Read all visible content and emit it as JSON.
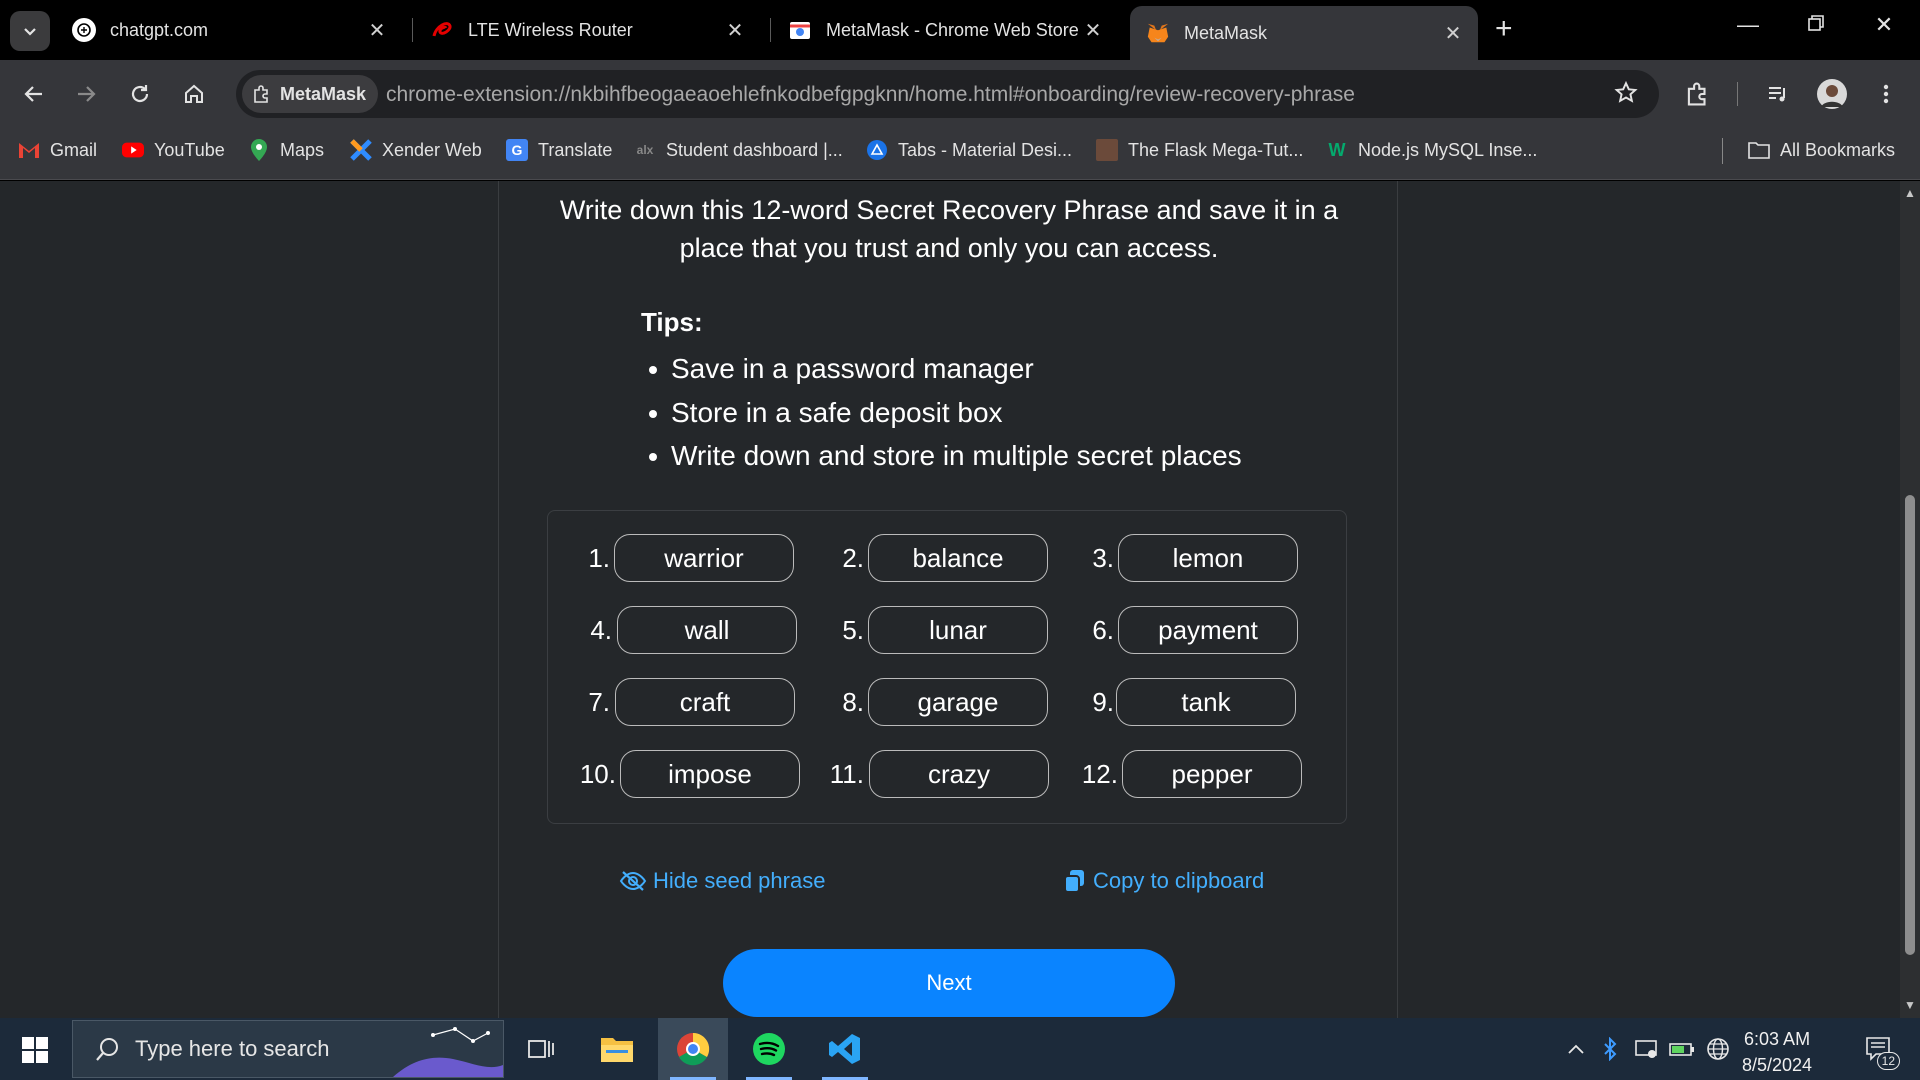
{
  "tabs": [
    {
      "title": "chatgpt.com",
      "icon": "chatgpt-icon"
    },
    {
      "title": "LTE Wireless Router",
      "icon": "airtel-icon"
    },
    {
      "title": "MetaMask - Chrome Web Store",
      "icon": "chrome-web-store-icon"
    },
    {
      "title": "MetaMask",
      "icon": "metamask-fox-icon",
      "active": true
    }
  ],
  "toolbar": {
    "site_chip": "MetaMask",
    "url": "chrome-extension://nkbihfbeogaeaoehlefnkodbefgpgknn/home.html#onboarding/review-recovery-phrase"
  },
  "bookmarks": [
    {
      "label": "Gmail",
      "icon": "gmail-icon"
    },
    {
      "label": "YouTube",
      "icon": "youtube-icon"
    },
    {
      "label": "Maps",
      "icon": "maps-icon"
    },
    {
      "label": "Xender Web",
      "icon": "xender-icon"
    },
    {
      "label": "Translate",
      "icon": "translate-icon"
    },
    {
      "label": "Student dashboard |...",
      "icon": "alx-icon"
    },
    {
      "label": "Tabs - Material Desi...",
      "icon": "material-icon"
    },
    {
      "label": "The Flask Mega-Tut...",
      "icon": "flask-icon"
    },
    {
      "label": "Node.js MySQL Inse...",
      "icon": "w3schools-icon"
    }
  ],
  "all_bookmarks": "All Bookmarks",
  "page": {
    "headline": "Write down this 12-word Secret Recovery Phrase and save it in a place that you trust and only you can access.",
    "tips_title": "Tips:",
    "tips": [
      "Save in a password manager",
      "Store in a safe deposit box",
      "Write down and store in multiple secret places"
    ],
    "words": [
      {
        "num": "1.",
        "word": "warrior"
      },
      {
        "num": "2.",
        "word": "balance"
      },
      {
        "num": "3.",
        "word": "lemon"
      },
      {
        "num": "4.",
        "word": "wall"
      },
      {
        "num": "5.",
        "word": "lunar"
      },
      {
        "num": "6.",
        "word": "payment"
      },
      {
        "num": "7.",
        "word": "craft"
      },
      {
        "num": "8.",
        "word": "garage"
      },
      {
        "num": "9.",
        "word": "tank"
      },
      {
        "num": "10.",
        "word": "impose"
      },
      {
        "num": "11.",
        "word": "crazy"
      },
      {
        "num": "12.",
        "word": "pepper"
      }
    ],
    "hide_label": "Hide seed phrase",
    "copy_label": "Copy to clipboard",
    "next_label": "Next"
  },
  "taskbar": {
    "search_placeholder": "Type here to search",
    "time": "6:03 AM",
    "date": "8/5/2024",
    "notifications": "12"
  },
  "colors": {
    "accent": "#0a84ff",
    "link": "#43aefc",
    "background": "#24272a"
  }
}
